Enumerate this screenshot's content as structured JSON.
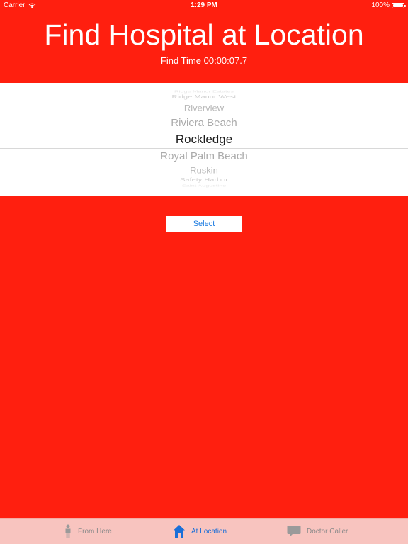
{
  "status_bar": {
    "carrier": "Carrier",
    "time": "1:29 PM",
    "battery": "100%"
  },
  "header": {
    "title": "Find Hospital at Location",
    "find_time": "Find Time 00:00:07.7"
  },
  "picker": {
    "items": [
      "Ridge Manor Estates",
      "Ridge Manor West",
      "Riverview",
      "Riviera Beach",
      "Rockledge",
      "Royal Palm Beach",
      "Ruskin",
      "Safety Harbor",
      "Saint Augustine"
    ],
    "selected": "Rockledge"
  },
  "select_button": {
    "label": "Select"
  },
  "tab_bar": {
    "tabs": [
      {
        "label": "From Here",
        "icon": "person-icon",
        "active": false
      },
      {
        "label": "At Location",
        "icon": "house-icon",
        "active": true
      },
      {
        "label": "Doctor Caller",
        "icon": "speech-bubble-icon",
        "active": false
      }
    ]
  },
  "colors": {
    "background": "#ff1f0f",
    "tab_active": "#1a6fd8",
    "tab_inactive": "#8a8a8a",
    "tab_bar_bg": "#f8c4bf"
  }
}
